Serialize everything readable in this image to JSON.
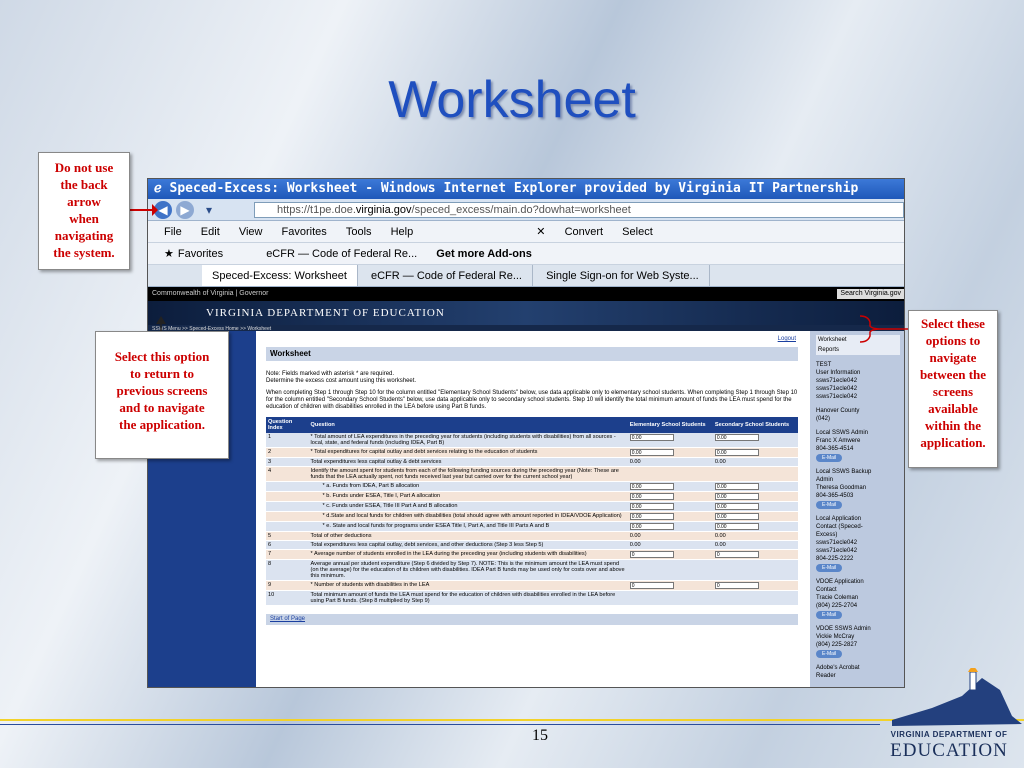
{
  "slide": {
    "title": "Worksheet",
    "page_number": "15",
    "colors": {
      "title": "#1f4fbf",
      "callout_text": "#cc0000",
      "nav_blue": "#1c3f8c"
    }
  },
  "callouts": {
    "back_arrow": "Do not use\nthe back\narrow\nwhen\nnavigating\nthe system.",
    "left_nav": "Select this option\nto return to\nprevious screens\nand to navigate\nthe application.",
    "right_nav": "Select these\noptions to\nnavigate\nbetween the\nscreens\navailable\nwithin the\napplication."
  },
  "browser": {
    "title": "Speced-Excess: Worksheet - Windows Internet Explorer provided by Virginia IT Partnership",
    "url_prefix": "https://t1pe.doe.",
    "url_domain": "virginia.gov",
    "url_path": "/speced_excess/main.do?dowhat=worksheet",
    "menu": [
      "File",
      "Edit",
      "View",
      "Favorites",
      "Tools",
      "Help",
      "Convert",
      "Select"
    ],
    "favorites": {
      "label": "Favorites",
      "item1": "eCFR — Code of Federal Re...",
      "item2": "Get more Add-ons"
    },
    "tabs": [
      "Speced-Excess: Worksheet",
      "eCFR — Code of Federal Re...",
      "Single Sign-on for Web Syste..."
    ]
  },
  "site": {
    "top_left": "Commonwealth of Virginia | Governor",
    "search": "Search Virginia.gov",
    "banner": "VIRGINIA DEPARTMENT OF EDUCATION",
    "crumb": "SSWS Menu >> Speced-Excess Home >> Worksheet",
    "logout": "Logout",
    "heading": "Worksheet",
    "note1": "Note: Fields marked with asterisk * are required.",
    "note2": "Determine the excess cost amount using this worksheet.",
    "paragraph": "When completing Step 1 through Step 10 for the column entitled \"Elementary School Students\" below, use data applicable only to elementary school students. When completing Step 1 through Step 10 for the column entitled \"Secondary School Students\" below, use data applicable only to secondary school students. Step 10 will identify the total minimum amount of funds the LEA must spend for the education of children with disabilities enrolled in the LEA before using Part B funds.",
    "columns": [
      "Question Index",
      "Question",
      "Elementary School Students",
      "Secondary School Students"
    ],
    "rows": [
      {
        "idx": "1",
        "q": "* Total amount of LEA expenditures in the preceding year for students (including students with disabilities) from all sources - local, state, and federal funds (including IDEA, Part B)",
        "e": "0.00",
        "s": "0.00"
      },
      {
        "idx": "2",
        "q": "* Total expenditures for capital outlay and debt services relating to the education of students",
        "e": "0.00",
        "s": "0.00"
      },
      {
        "idx": "3",
        "q": "Total expenditures less capital outlay & debt services",
        "e": "0.00",
        "s": "0.00"
      },
      {
        "idx": "4",
        "q": "Identify the amount spent for students from each of the following funding sources during the preceding year (Note: These are funds that the LEA actually spent, not funds received last year but carried over for the current school year)",
        "e": "",
        "s": ""
      },
      {
        "idx": "",
        "q": "* a. Funds from IDEA, Part B allocation",
        "e": "0.00",
        "s": "0.00"
      },
      {
        "idx": "",
        "q": "* b. Funds under ESEA, Title I, Part A allocation",
        "e": "0.00",
        "s": "0.00"
      },
      {
        "idx": "",
        "q": "* c. Funds under ESEA, Title III Part A and B allocation",
        "e": "0.00",
        "s": "0.00"
      },
      {
        "idx": "",
        "q": "* d.State and local funds for children with disabilities (total should agree with amount reported in IDEA/VDOE Application)",
        "e": "0.00",
        "s": "0.00"
      },
      {
        "idx": "",
        "q": "* e. State and local funds for programs under ESEA Title I, Part A, and Title III Parts A and B",
        "e": "0.00",
        "s": "0.00"
      },
      {
        "idx": "5",
        "q": "Total of other deductions",
        "e": "0.00",
        "s": "0.00"
      },
      {
        "idx": "6",
        "q": "Total expenditures less capital outlay, debt services, and other deductions (Step 3 less Step 5)",
        "e": "0.00",
        "s": "0.00"
      },
      {
        "idx": "7",
        "q": "* Average number of students enrolled in the LEA during the preceding year (including students with disabilities)",
        "e": "0",
        "s": "0"
      },
      {
        "idx": "8",
        "q": "Average annual per student expenditure (Step 6 divided by Step 7). NOTE: This is the minimum amount the LEA must spend (on the average) for the education of its children with disabilities. IDEA Part B funds may be used only for costs over and above this minimum.",
        "e": "",
        "s": ""
      },
      {
        "idx": "9",
        "q": "* Number of students with disabilities in the LEA",
        "e": "0",
        "s": "0"
      },
      {
        "idx": "10",
        "q": "Total minimum amount of funds the LEA must spend for the education of children with disabilities enrolled in the LEA before using Part B funds. (Step 8 multiplied by Step 9)",
        "e": "",
        "s": ""
      }
    ],
    "start_of_page": "Start of Page",
    "right_links": [
      "Worksheet",
      "Reports"
    ],
    "right_info": [
      {
        "text": "TEST\nUser Information\nssws71ecle042\nssws71ecle042\nssws71ecle042",
        "button": ""
      },
      {
        "text": "Hanover County\n(042)",
        "button": ""
      },
      {
        "text": "Local SSWS Admin\nFranc X Amwere\n804-365-4514",
        "button": "E-Mail"
      },
      {
        "text": "Local SSWS Backup\nAdmin\nTheresa Goodman\n804-365-4503",
        "button": "E-Mail"
      },
      {
        "text": "Local Application\nContact (Speced-\nExcess)\nssws71ecle042\nssws71ecle042\n804-225-2222",
        "button": "E-Mail"
      },
      {
        "text": "VDOE Application\nContact\nTracie Coleman\n(804) 225-2704",
        "button": "E-Mail"
      },
      {
        "text": "VDOE SSWS Admin\nVickie McCray\n(804) 225-2827",
        "button": "E-Mail"
      },
      {
        "text": "Adobe's Acrobat\nReader",
        "button": ""
      }
    ]
  },
  "logo": {
    "line1": "VIRGINIA DEPARTMENT OF",
    "line2": "EDUCATION"
  }
}
